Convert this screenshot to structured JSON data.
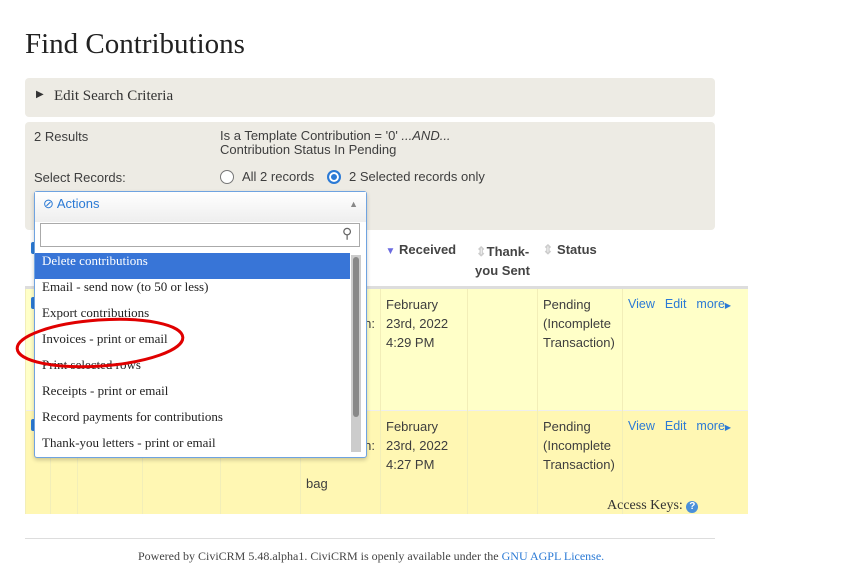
{
  "page_title": "Find Contributions",
  "criteria": {
    "label": "Edit Search Criteria"
  },
  "results": {
    "count": "2 Results",
    "query_line1": "Is a Template Contribution = '0' ",
    "query_and": "...AND...",
    "query_line2": "Contribution Status In Pending",
    "select_label": "Select Records:",
    "opt_all": "All 2 records",
    "opt_selected": "2 Selected records only",
    "selected": "selected"
  },
  "actions": {
    "label": "Actions",
    "search_value": "",
    "options": [
      "Delete contributions",
      "Email - send now (to 50 or less)",
      "Export contributions",
      "Invoices - print or email",
      "Print selected rows",
      "Receipts - print or email",
      "Record payments for contributions",
      "Thank-you letters - print or email"
    ],
    "highlighted": "Delete contributions",
    "annotated": "Invoices - print or email"
  },
  "table": {
    "headers": {
      "received": "Received",
      "thankyou": "Thank-you Sent",
      "status": "Status"
    },
    "rows": [
      {
        "partial": "n:",
        "received": [
          "February",
          "23rd, 2022",
          "4:29 PM"
        ],
        "status": [
          "Pending",
          "(Incomplete",
          "Transaction)"
        ]
      },
      {
        "partial": "n:",
        "partial2": "bag",
        "received": [
          "February",
          "23rd, 2022",
          "4:27 PM"
        ],
        "status": [
          "Pending",
          "(Incomplete",
          "Transaction)"
        ]
      }
    ],
    "links": {
      "view": "View",
      "edit": "Edit",
      "more": "more"
    }
  },
  "access_keys": "Access Keys:",
  "footer": {
    "text": "Powered by CiviCRM 5.48.alpha1. CiviCRM is openly available under the ",
    "link": "GNU AGPL License."
  },
  "colors": {
    "accent": "#2b7ad5",
    "highlight": "#3875d7",
    "annotation": "#e00000"
  }
}
